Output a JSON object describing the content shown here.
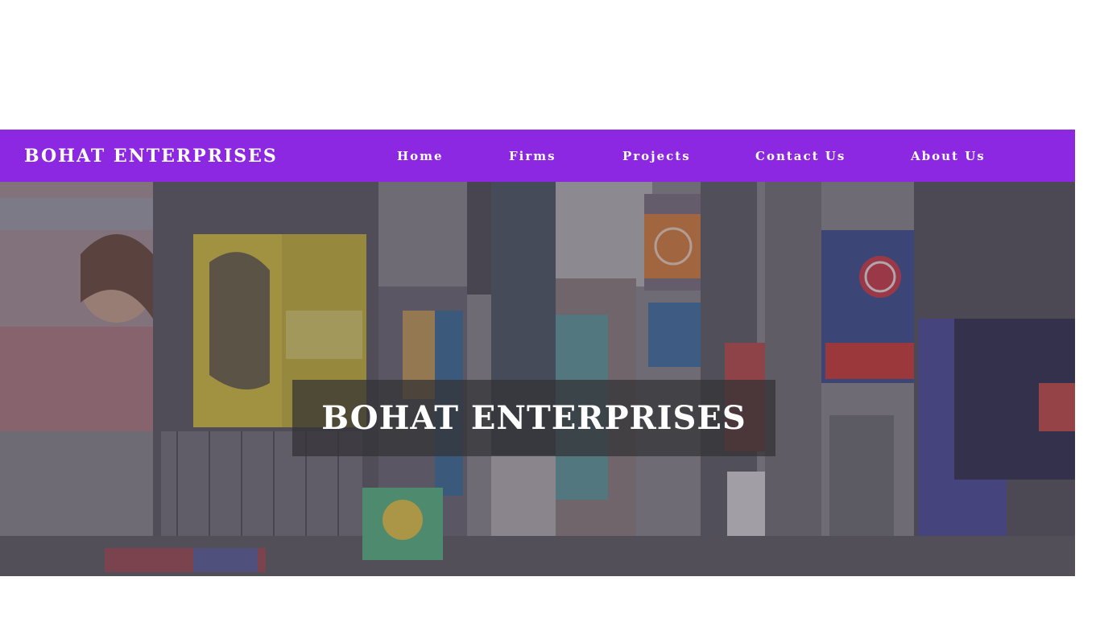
{
  "navbar": {
    "brand": "BOHAT ENTERPRISES",
    "links": [
      {
        "label": "Home"
      },
      {
        "label": "Firms"
      },
      {
        "label": "Projects"
      },
      {
        "label": "Contact Us"
      },
      {
        "label": "About Us"
      }
    ],
    "background_color": "#8d28e2"
  },
  "hero": {
    "title": "BOHAT ENTERPRISES",
    "image_description_icon": "city-street-billboards-image"
  }
}
